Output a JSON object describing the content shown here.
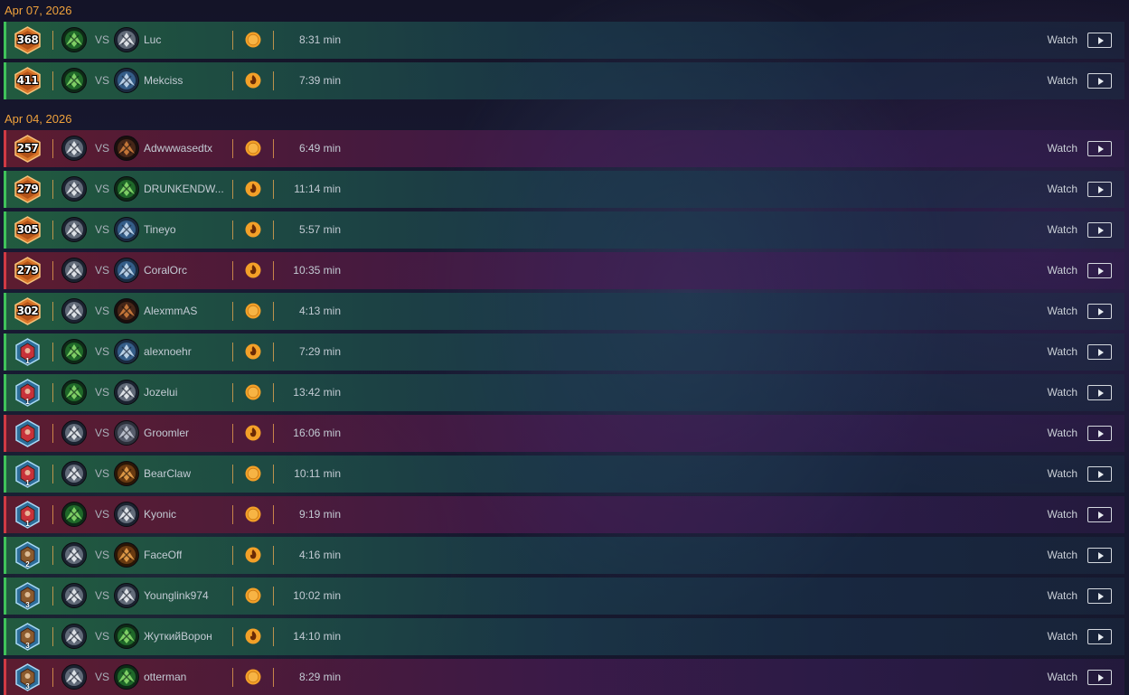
{
  "days": [
    {
      "date": "Apr 07, 2026",
      "matches": [
        {
          "result": "win",
          "rank_type": "legend",
          "rank": "368",
          "tier": "",
          "player_hero": "warlock-green",
          "vs": "VS",
          "opponent_hero": "priest-white",
          "opponent": "Luc",
          "mode": "coin",
          "duration": "8:31 min",
          "watch": "Watch"
        },
        {
          "result": "win",
          "rank_type": "legend",
          "rank": "411",
          "tier": "",
          "player_hero": "warlock-green",
          "vs": "VS",
          "opponent_hero": "warrior-blue",
          "opponent": "Mekciss",
          "mode": "flame",
          "duration": "7:39 min",
          "watch": "Watch"
        }
      ]
    },
    {
      "date": "Apr 04, 2026",
      "matches": [
        {
          "result": "loss",
          "rank_type": "legend",
          "rank": "257",
          "tier": "",
          "player_hero": "priest-white",
          "vs": "VS",
          "opponent_hero": "rogue-dark",
          "opponent": "Adwwwasedtx",
          "mode": "coin",
          "duration": "6:49 min",
          "watch": "Watch"
        },
        {
          "result": "win",
          "rank_type": "legend",
          "rank": "279",
          "tier": "",
          "player_hero": "priest-white",
          "vs": "VS",
          "opponent_hero": "warlock-green",
          "opponent": "DRUNKENDW...",
          "mode": "flame",
          "duration": "11:14 min",
          "watch": "Watch"
        },
        {
          "result": "win",
          "rank_type": "legend",
          "rank": "305",
          "tier": "",
          "player_hero": "priest-white",
          "vs": "VS",
          "opponent_hero": "warrior-blue",
          "opponent": "Tineyo",
          "mode": "flame",
          "duration": "5:57 min",
          "watch": "Watch"
        },
        {
          "result": "loss",
          "rank_type": "legend",
          "rank": "279",
          "tier": "",
          "player_hero": "priest-white",
          "vs": "VS",
          "opponent_hero": "warrior-blue",
          "opponent": "CoralOrc",
          "mode": "flame",
          "duration": "10:35 min",
          "watch": "Watch"
        },
        {
          "result": "win",
          "rank_type": "legend",
          "rank": "302",
          "tier": "",
          "player_hero": "priest-white",
          "vs": "VS",
          "opponent_hero": "rogue-dark",
          "opponent": "AlexmmAS",
          "mode": "coin",
          "duration": "4:13 min",
          "watch": "Watch"
        },
        {
          "result": "win",
          "rank_type": "diamond",
          "rank": "",
          "tier": "1",
          "player_hero": "warlock-green",
          "vs": "VS",
          "opponent_hero": "warrior-blue",
          "opponent": "alexnoehr",
          "mode": "flame",
          "duration": "7:29 min",
          "watch": "Watch"
        },
        {
          "result": "win",
          "rank_type": "diamond",
          "rank": "",
          "tier": "1",
          "player_hero": "warlock-green",
          "vs": "VS",
          "opponent_hero": "priest-white",
          "opponent": "Jozelui",
          "mode": "coin",
          "duration": "13:42 min",
          "watch": "Watch"
        },
        {
          "result": "loss",
          "rank_type": "diamond",
          "rank": "",
          "tier": "",
          "player_hero": "priest-white",
          "vs": "VS",
          "opponent_hero": "mage-grey",
          "opponent": "Groomler",
          "mode": "flame",
          "duration": "16:06 min",
          "watch": "Watch"
        },
        {
          "result": "win",
          "rank_type": "diamond",
          "rank": "",
          "tier": "1",
          "player_hero": "priest-white",
          "vs": "VS",
          "opponent_hero": "druid-brown",
          "opponent": "BearClaw",
          "mode": "coin",
          "duration": "10:11 min",
          "watch": "Watch"
        },
        {
          "result": "loss",
          "rank_type": "diamond",
          "rank": "",
          "tier": "1",
          "player_hero": "warlock-green",
          "vs": "VS",
          "opponent_hero": "priest-white",
          "opponent": "Kyonic",
          "mode": "coin",
          "duration": "9:19 min",
          "watch": "Watch"
        },
        {
          "result": "win",
          "rank_type": "diamond-brown",
          "rank": "",
          "tier": "2",
          "player_hero": "priest-white",
          "vs": "VS",
          "opponent_hero": "druid-brown",
          "opponent": "FaceOff",
          "mode": "flame",
          "duration": "4:16 min",
          "watch": "Watch"
        },
        {
          "result": "win",
          "rank_type": "diamond-brown",
          "rank": "",
          "tier": "3",
          "player_hero": "priest-white",
          "vs": "VS",
          "opponent_hero": "priest-white",
          "opponent": "Younglink974",
          "mode": "coin",
          "duration": "10:02 min",
          "watch": "Watch"
        },
        {
          "result": "win",
          "rank_type": "diamond-brown",
          "rank": "",
          "tier": "3",
          "player_hero": "priest-white",
          "vs": "VS",
          "opponent_hero": "warlock-green",
          "opponent": "ЖуткийВорон",
          "mode": "flame",
          "duration": "14:10 min",
          "watch": "Watch"
        },
        {
          "result": "loss",
          "rank_type": "diamond-brown",
          "rank": "",
          "tier": "3",
          "player_hero": "priest-white",
          "vs": "VS",
          "opponent_hero": "warlock-green",
          "opponent": "otterman",
          "mode": "coin",
          "duration": "8:29 min",
          "watch": "Watch"
        }
      ]
    }
  ],
  "colors": {
    "date_header": "#f0a23c",
    "win_border": "#3fc25a",
    "loss_border": "#d03a44",
    "separator": "#f0aa50",
    "coin": "#f3a028"
  }
}
